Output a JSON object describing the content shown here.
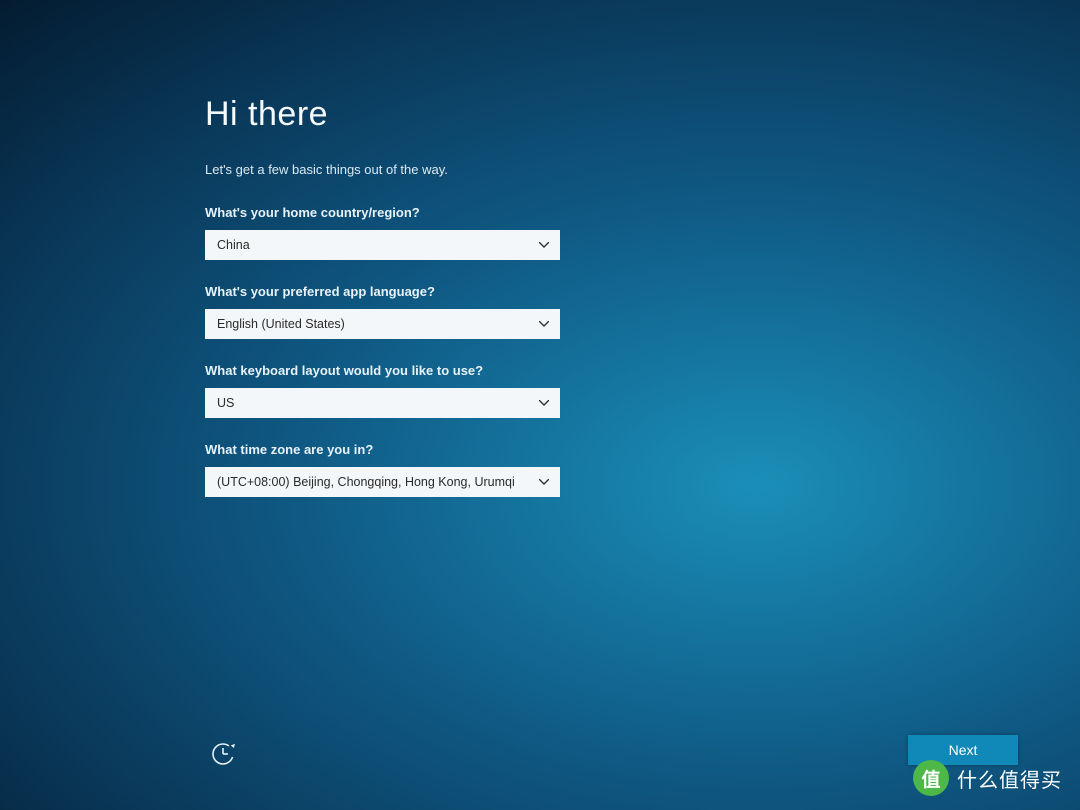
{
  "heading": "Hi there",
  "subheading": "Let's get a few basic things out of the way.",
  "fields": {
    "country": {
      "label": "What's your home country/region?",
      "value": "China"
    },
    "language": {
      "label": "What's your preferred app language?",
      "value": "English (United States)"
    },
    "keyboard": {
      "label": "What keyboard layout would you like to use?",
      "value": "US"
    },
    "timezone": {
      "label": "What time zone are you in?",
      "value": "(UTC+08:00) Beijing, Chongqing, Hong Kong, Urumqi"
    }
  },
  "buttons": {
    "next": "Next"
  },
  "watermark": {
    "badge": "值",
    "text": "什么值得买"
  }
}
